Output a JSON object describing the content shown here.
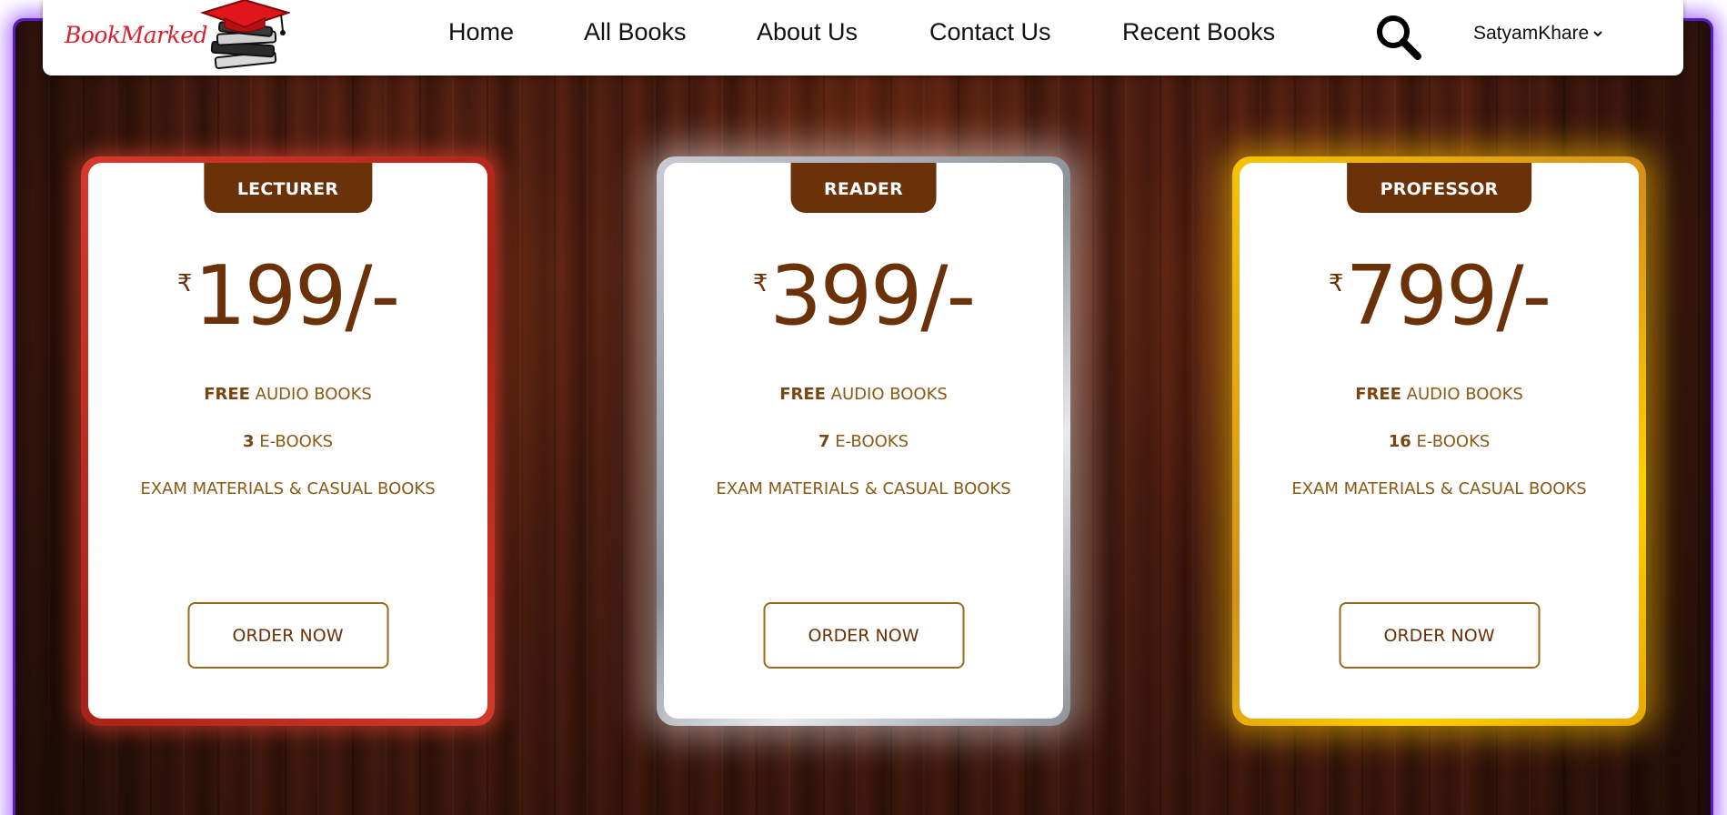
{
  "brand": {
    "name": "BookMarked",
    "logo_icon": "graduation-cap-books-icon"
  },
  "nav": {
    "links": [
      "Home",
      "All Books",
      "About Us",
      "Contact Us",
      "Recent Books"
    ],
    "search_icon": "search-icon",
    "user_name": "SatyamKhare",
    "user_menu_icon": "chevron-down-icon"
  },
  "plans": [
    {
      "tier": "LECTURER",
      "currency": "₹",
      "price": "199/-",
      "features": [
        {
          "bold": "FREE",
          "text": " AUDIO BOOKS"
        },
        {
          "bold": "3",
          "text": " E-BOOKS"
        },
        {
          "bold": "",
          "text": "EXAM MATERIALS & CASUAL BOOKS"
        }
      ],
      "cta": "ORDER NOW",
      "border_color": "#c0302a"
    },
    {
      "tier": "READER",
      "currency": "₹",
      "price": "399/-",
      "features": [
        {
          "bold": "FREE",
          "text": " AUDIO BOOKS"
        },
        {
          "bold": "7",
          "text": " E-BOOKS"
        },
        {
          "bold": "",
          "text": "EXAM MATERIALS & CASUAL BOOKS"
        }
      ],
      "cta": "ORDER NOW",
      "border_color": "#a4a8ae"
    },
    {
      "tier": "PROFESSOR",
      "currency": "₹",
      "price": "799/-",
      "features": [
        {
          "bold": "FREE",
          "text": " AUDIO BOOKS"
        },
        {
          "bold": "16",
          "text": " E-BOOKS"
        },
        {
          "bold": "",
          "text": "EXAM MATERIALS & CASUAL BOOKS"
        }
      ],
      "cta": "ORDER NOW",
      "border_color": "#e9b000"
    }
  ],
  "colors": {
    "accent_brown": "#6b3108",
    "text_gold": "#8a5a14",
    "frame_purple": "#5a1cc7",
    "brand_red": "#d8202e"
  }
}
